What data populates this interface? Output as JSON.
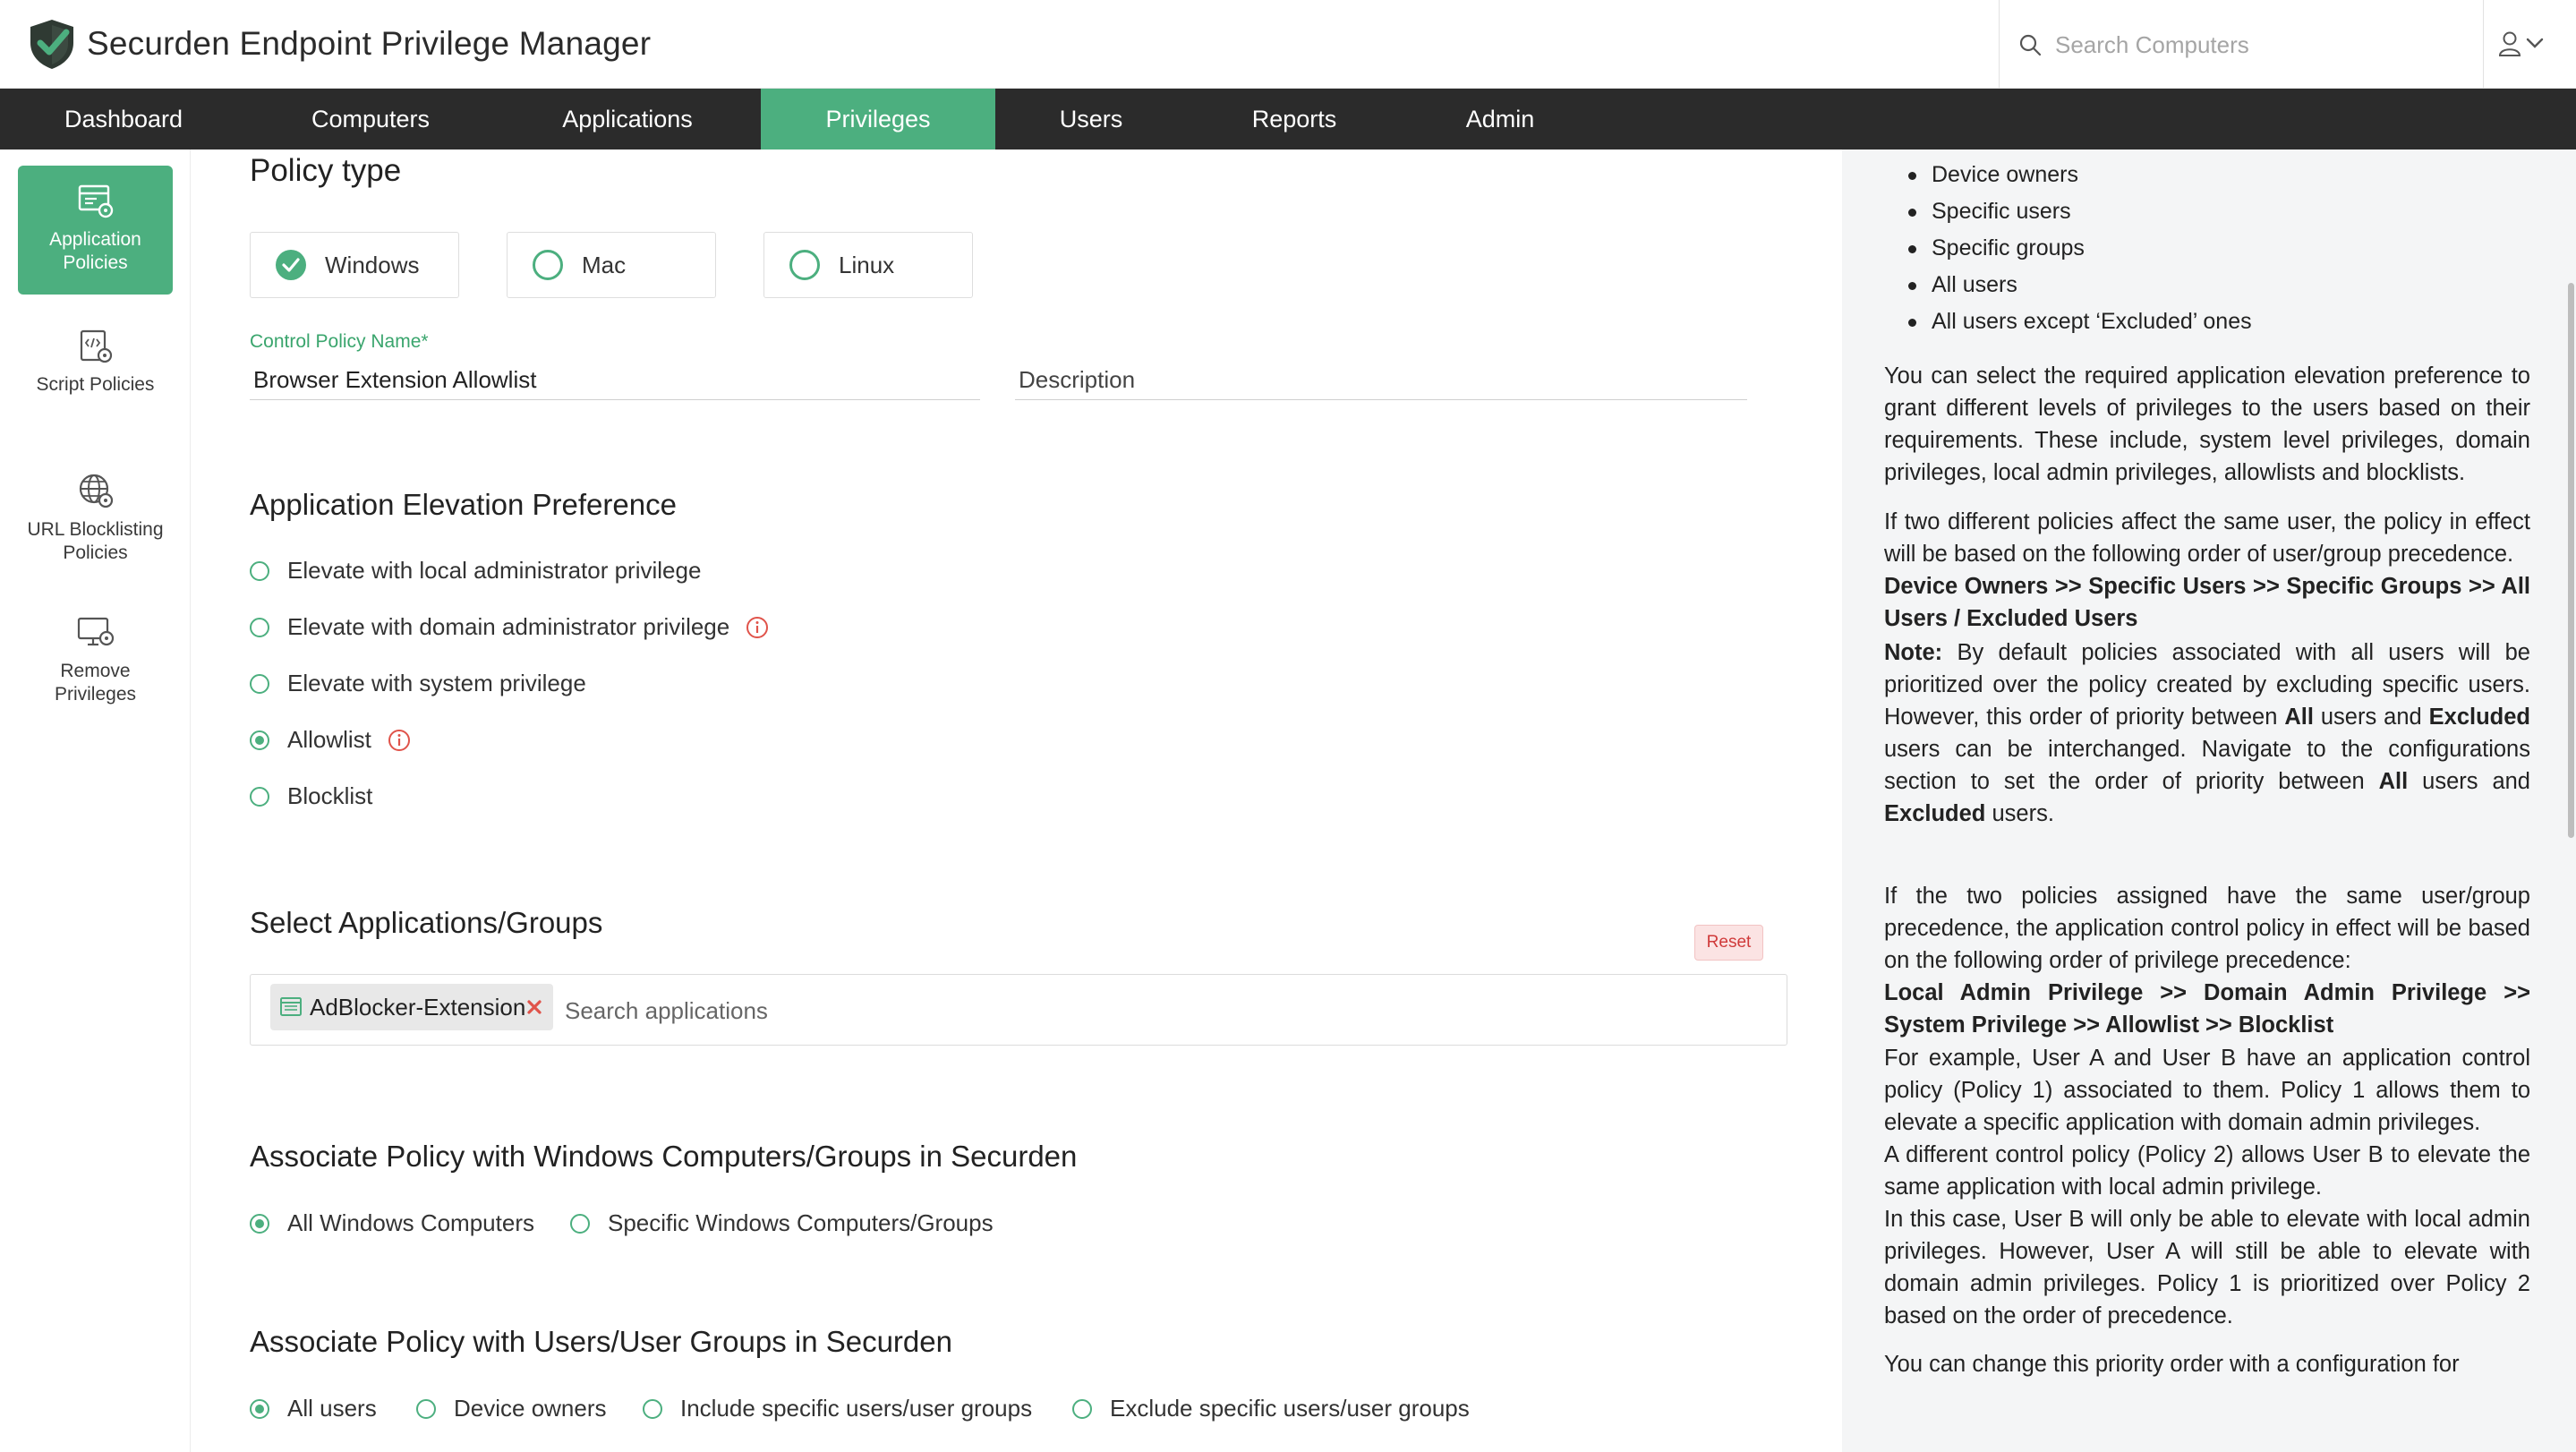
{
  "app": {
    "title": "Securden Endpoint Privilege Manager",
    "brand_color": "#4caf7f",
    "search_placeholder": "Search Computers"
  },
  "nav": {
    "items": [
      "Dashboard",
      "Computers",
      "Applications",
      "Privileges",
      "Users",
      "Reports",
      "Admin"
    ],
    "active": "Privileges"
  },
  "sidebar": {
    "items": [
      {
        "label": "Application Policies",
        "icon": "application-policy-icon",
        "active": true
      },
      {
        "label": "Script Policies",
        "icon": "script-policy-icon",
        "active": false
      },
      {
        "label": "URL Blocklisting Policies",
        "icon": "globe-icon",
        "active": false
      },
      {
        "label": "Remove Privileges",
        "icon": "remove-privilege-icon",
        "active": false
      }
    ]
  },
  "form": {
    "policy_type_heading": "Policy type",
    "policy_types": [
      {
        "label": "Windows",
        "selected": true
      },
      {
        "label": "Mac",
        "selected": false
      },
      {
        "label": "Linux",
        "selected": false
      }
    ],
    "name_label": "Control Policy Name*",
    "name_value": "Browser Extension Allowlist",
    "description_placeholder": "Description",
    "elevation_heading": "Application Elevation Preference",
    "elevation_options": [
      {
        "label": "Elevate with local administrator privilege",
        "selected": false,
        "info": false
      },
      {
        "label": "Elevate with domain administrator privilege",
        "selected": false,
        "info": true
      },
      {
        "label": "Elevate with system privilege",
        "selected": false,
        "info": false
      },
      {
        "label": "Allowlist",
        "selected": true,
        "info": true
      },
      {
        "label": "Blocklist",
        "selected": false,
        "info": false
      }
    ],
    "apps_heading": "Select Applications/Groups",
    "reset_label": "Reset",
    "selected_apps": [
      "AdBlocker-Extension"
    ],
    "app_search_placeholder": "Search applications",
    "computers_heading": "Associate Policy with Windows Computers/Groups in Securden",
    "computer_options": [
      {
        "label": "All Windows Computers",
        "selected": true
      },
      {
        "label": "Specific Windows Computers/Groups",
        "selected": false
      }
    ],
    "users_heading": "Associate Policy with Users/User Groups in Securden",
    "user_options": [
      {
        "label": "All users",
        "selected": true
      },
      {
        "label": "Device owners",
        "selected": false
      },
      {
        "label": "Include specific users/user groups",
        "selected": false
      },
      {
        "label": "Exclude specific users/user groups",
        "selected": false
      }
    ]
  },
  "help": {
    "bullets": [
      "Device owners",
      "Specific users",
      "Specific groups",
      "All users",
      "All users except ‘Excluded’ ones"
    ],
    "p1": "You can select the required application elevation preference to grant different levels of privileges to the users based on their requirements. These include, system level privileges, domain privileges, local admin privileges, allowlists and blocklists.",
    "p2": "If two different policies affect the same user, the policy in effect will be based on the following order of user/group precedence.",
    "p3": "Device Owners >> Specific Users >> Specific Groups >> All Users / Excluded Users",
    "p4_note": "Note:",
    "p4_a": " By default policies associated with all users will be prioritized over the policy created by excluding specific users. However, this order of priority between ",
    "p4_all1": "All",
    "p4_b": " users and ",
    "p4_excl1": "Excluded",
    "p4_c": " users can be interchanged. Navigate to the configurations section to set the order of priority between ",
    "p4_all2": "All",
    "p4_d": " users and ",
    "p4_excl2": "Excluded",
    "p4_e": " users.",
    "p5": "If the two policies assigned have the same user/group precedence, the application control policy in effect will be based on the following order of privilege precedence:",
    "p6": "Local Admin Privilege >> Domain Admin Privilege >> System Privilege >> Allowlist >> Blocklist",
    "p7": "For example, User A and User B have an application control policy (Policy 1) associated to them. Policy 1 allows them to elevate a specific application with domain admin privileges.",
    "p8": "A different control policy (Policy 2) allows User B to elevate the same application with local admin privilege.",
    "p9": "In this case, User B will only be able to elevate with local admin privileges. However, User A will still be able to elevate with domain admin privileges. Policy 1 is prioritized over Policy 2 based on the order of precedence.",
    "p10": "You can change this priority order with a configuration for"
  }
}
